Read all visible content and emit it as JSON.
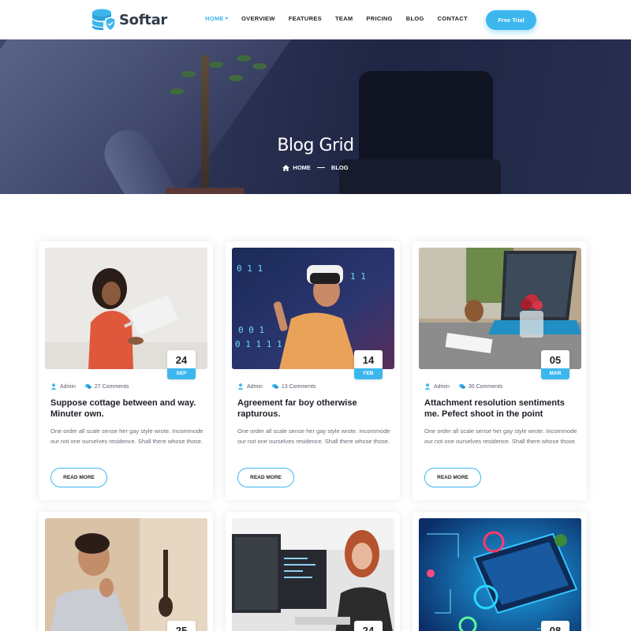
{
  "header": {
    "logo_text": "Softar",
    "nav": [
      {
        "label": "HOME",
        "active": true
      },
      {
        "label": "OVERVIEW",
        "active": false
      },
      {
        "label": "FEATURES",
        "active": false
      },
      {
        "label": "TEAM",
        "active": false
      },
      {
        "label": "PRICING",
        "active": false
      },
      {
        "label": "BLOG",
        "active": false
      },
      {
        "label": "CONTACT",
        "active": false
      }
    ],
    "cta_label": "Free Trial",
    "accent_color": "#3cb7ee"
  },
  "hero": {
    "title": "Blog Grid",
    "breadcrumb": {
      "home": "HOME",
      "current": "BLOG"
    }
  },
  "posts": [
    {
      "day": "24",
      "month": "SEP",
      "author": "Admin",
      "comments": "27 Comments",
      "title": "Suppose cottage between and way. Minuter own.",
      "excerpt": "One order all scale sense her gay style wrote. Incommode our not one ourselves residence. Shall there whose those.",
      "button": "READ MORE"
    },
    {
      "day": "14",
      "month": "FEB",
      "author": "Admin",
      "comments": "13 Comments",
      "title": "Agreement far boy otherwise rapturous.",
      "excerpt": "One order all scale sense her gay style wrote. Incommode our not one ourselves residence. Shall there whose those.",
      "button": "READ MORE"
    },
    {
      "day": "05",
      "month": "MAR",
      "author": "Admin",
      "comments": "30 Comments",
      "title": "Attachment resolution sentiments me. Pefect shoot in the point",
      "excerpt": "One order all scale sense her gay style wrote. Incommode our not one ourselves residence. Shall there whose those.",
      "button": "READ MORE"
    },
    {
      "day": "25"
    },
    {
      "day": "24"
    },
    {
      "day": "08"
    }
  ]
}
